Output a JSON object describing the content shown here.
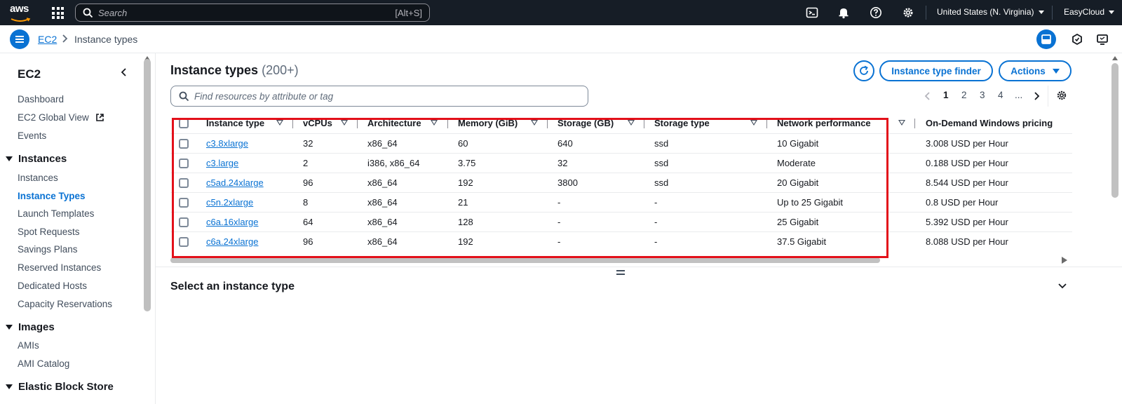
{
  "topbar": {
    "logo_text": "aws",
    "search_placeholder": "Search",
    "search_shortcut": "[Alt+S]",
    "region": "United States (N. Virginia)",
    "account": "EasyCloud",
    "icons": [
      "cloudshell-icon",
      "notifications-icon",
      "help-icon",
      "settings-icon"
    ]
  },
  "breadcrumb": {
    "items": [
      "EC2",
      "Instance types"
    ]
  },
  "sidebar": {
    "title": "EC2",
    "items": [
      {
        "label": "Dashboard"
      },
      {
        "label": "EC2 Global View"
      },
      {
        "label": "Events"
      }
    ],
    "sections": [
      {
        "label": "Instances",
        "items": [
          "Instances",
          "Instance Types",
          "Launch Templates",
          "Spot Requests",
          "Savings Plans",
          "Reserved Instances",
          "Dedicated Hosts",
          "Capacity Reservations"
        ]
      },
      {
        "label": "Images",
        "items": [
          "AMIs",
          "AMI Catalog"
        ]
      },
      {
        "label": "Elastic Block Store",
        "items": []
      }
    ],
    "active_item": "Instance Types"
  },
  "main": {
    "title": "Instance types",
    "count": "(200+)",
    "finder_button": "Instance type finder",
    "actions_button": "Actions",
    "filter_placeholder": "Find resources by attribute or tag",
    "pagination": [
      "1",
      "2",
      "3",
      "4",
      "..."
    ],
    "current_page": "1",
    "columns": [
      "Instance type",
      "vCPUs",
      "Architecture",
      "Memory (GiB)",
      "Storage (GB)",
      "Storage type",
      "Network performance",
      "On-Demand Windows pricing"
    ],
    "rows": [
      {
        "type": "c3.8xlarge",
        "vcpus": "32",
        "arch": "x86_64",
        "mem": "60",
        "storage": "640",
        "stype": "ssd",
        "net": "10 Gigabit",
        "price": "3.008 USD per Hour"
      },
      {
        "type": "c3.large",
        "vcpus": "2",
        "arch": "i386, x86_64",
        "mem": "3.75",
        "storage": "32",
        "stype": "ssd",
        "net": "Moderate",
        "price": "0.188 USD per Hour"
      },
      {
        "type": "c5ad.24xlarge",
        "vcpus": "96",
        "arch": "x86_64",
        "mem": "192",
        "storage": "3800",
        "stype": "ssd",
        "net": "20 Gigabit",
        "price": "8.544 USD per Hour"
      },
      {
        "type": "c5n.2xlarge",
        "vcpus": "8",
        "arch": "x86_64",
        "mem": "21",
        "storage": "-",
        "stype": "-",
        "net": "Up to 25 Gigabit",
        "price": "0.8 USD per Hour"
      },
      {
        "type": "c6a.16xlarge",
        "vcpus": "64",
        "arch": "x86_64",
        "mem": "128",
        "storage": "-",
        "stype": "-",
        "net": "25 Gigabit",
        "price": "5.392 USD per Hour"
      },
      {
        "type": "c6a.24xlarge",
        "vcpus": "96",
        "arch": "x86_64",
        "mem": "192",
        "storage": "-",
        "stype": "-",
        "net": "37.5 Gigabit",
        "price": "8.088 USD per Hour"
      }
    ],
    "split_panel_title": "Select an instance type"
  },
  "colors": {
    "topbar_bg": "#161d26",
    "accent": "#0972d3",
    "highlight": "#e3101a"
  }
}
